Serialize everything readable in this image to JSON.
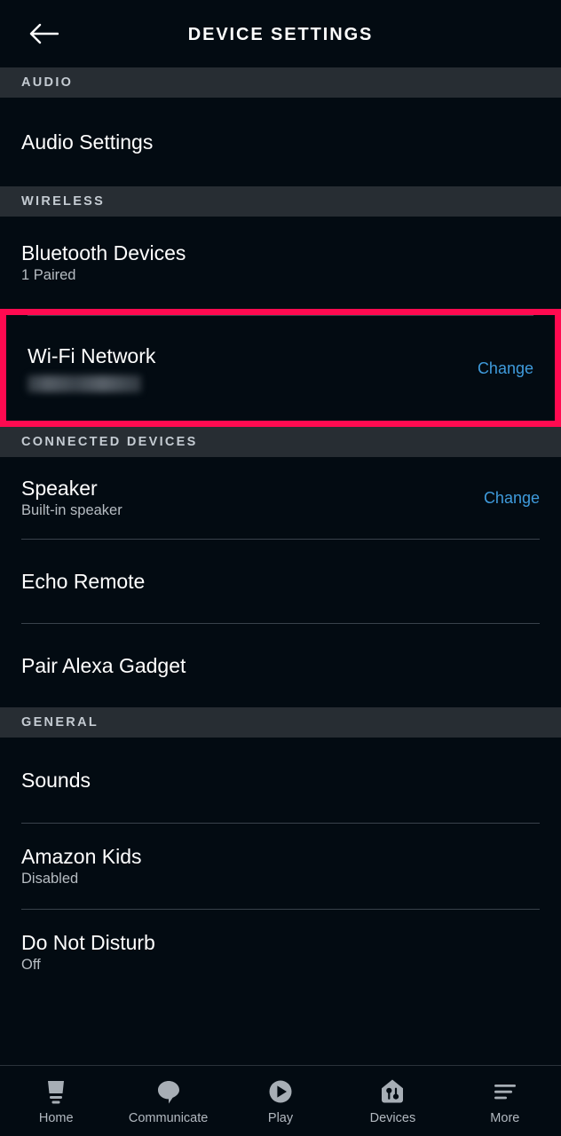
{
  "header": {
    "title": "DEVICE SETTINGS",
    "back_icon": "arrow-left-icon"
  },
  "sections": [
    {
      "id": "audio",
      "label": "AUDIO",
      "rows": [
        {
          "title": "Audio Settings",
          "sub": null,
          "action": null
        }
      ]
    },
    {
      "id": "wireless",
      "label": "WIRELESS",
      "rows": [
        {
          "title": "Bluetooth Devices",
          "sub": "1 Paired",
          "action": null
        },
        {
          "title": "Wi-Fi Network",
          "sub": "",
          "sub_redacted": true,
          "action": "Change",
          "highlighted": true
        }
      ]
    },
    {
      "id": "connected_devices",
      "label": "CONNECTED DEVICES",
      "rows": [
        {
          "title": "Speaker",
          "sub": "Built-in speaker",
          "action": "Change"
        },
        {
          "title": "Echo Remote",
          "sub": null,
          "action": null
        },
        {
          "title": "Pair Alexa Gadget",
          "sub": null,
          "action": null
        }
      ]
    },
    {
      "id": "general",
      "label": "GENERAL",
      "rows": [
        {
          "title": "Sounds",
          "sub": null,
          "action": null
        },
        {
          "title": "Amazon Kids",
          "sub": "Disabled",
          "action": null
        },
        {
          "title": "Do Not Disturb",
          "sub": "Off",
          "action": null
        }
      ]
    }
  ],
  "bottom_nav": [
    {
      "label": "Home",
      "icon": "echo-device-icon"
    },
    {
      "label": "Communicate",
      "icon": "speech-bubble-icon"
    },
    {
      "label": "Play",
      "icon": "play-circle-icon"
    },
    {
      "label": "Devices",
      "icon": "house-devices-icon"
    },
    {
      "label": "More",
      "icon": "hamburger-menu-icon"
    }
  ],
  "colors": {
    "background": "#030b12",
    "section_header_bg": "#272d33",
    "accent_link": "#3f9bdc",
    "highlight_border": "#ff0a50",
    "divider": "#39424b",
    "nav_icon": "#a7aeb5"
  }
}
